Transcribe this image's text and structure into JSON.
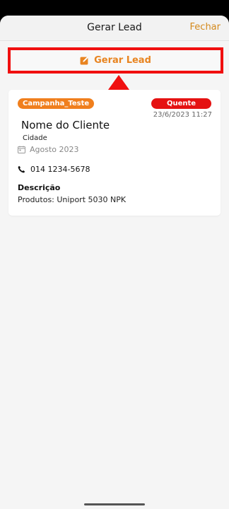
{
  "header": {
    "title": "Gerar Lead",
    "close_label": "Fechar"
  },
  "action": {
    "generate_label": "Gerar Lead",
    "icon": "edit-icon"
  },
  "lead": {
    "campaign": "Campanha_Teste",
    "temperature": "Quente",
    "datetime": "23/6/2023 11:27",
    "client_name": "Nome do Cliente",
    "city": "Cidade",
    "month": "Agosto 2023",
    "phone": "014 1234-5678",
    "description_title": "Descrição",
    "description": "Produtos: Uniport 5030 NPK"
  },
  "colors": {
    "accent": "#e88420",
    "campaign_badge": "#f07f1d",
    "temperature_badge": "#e51212",
    "highlight": "#f00f0f"
  }
}
